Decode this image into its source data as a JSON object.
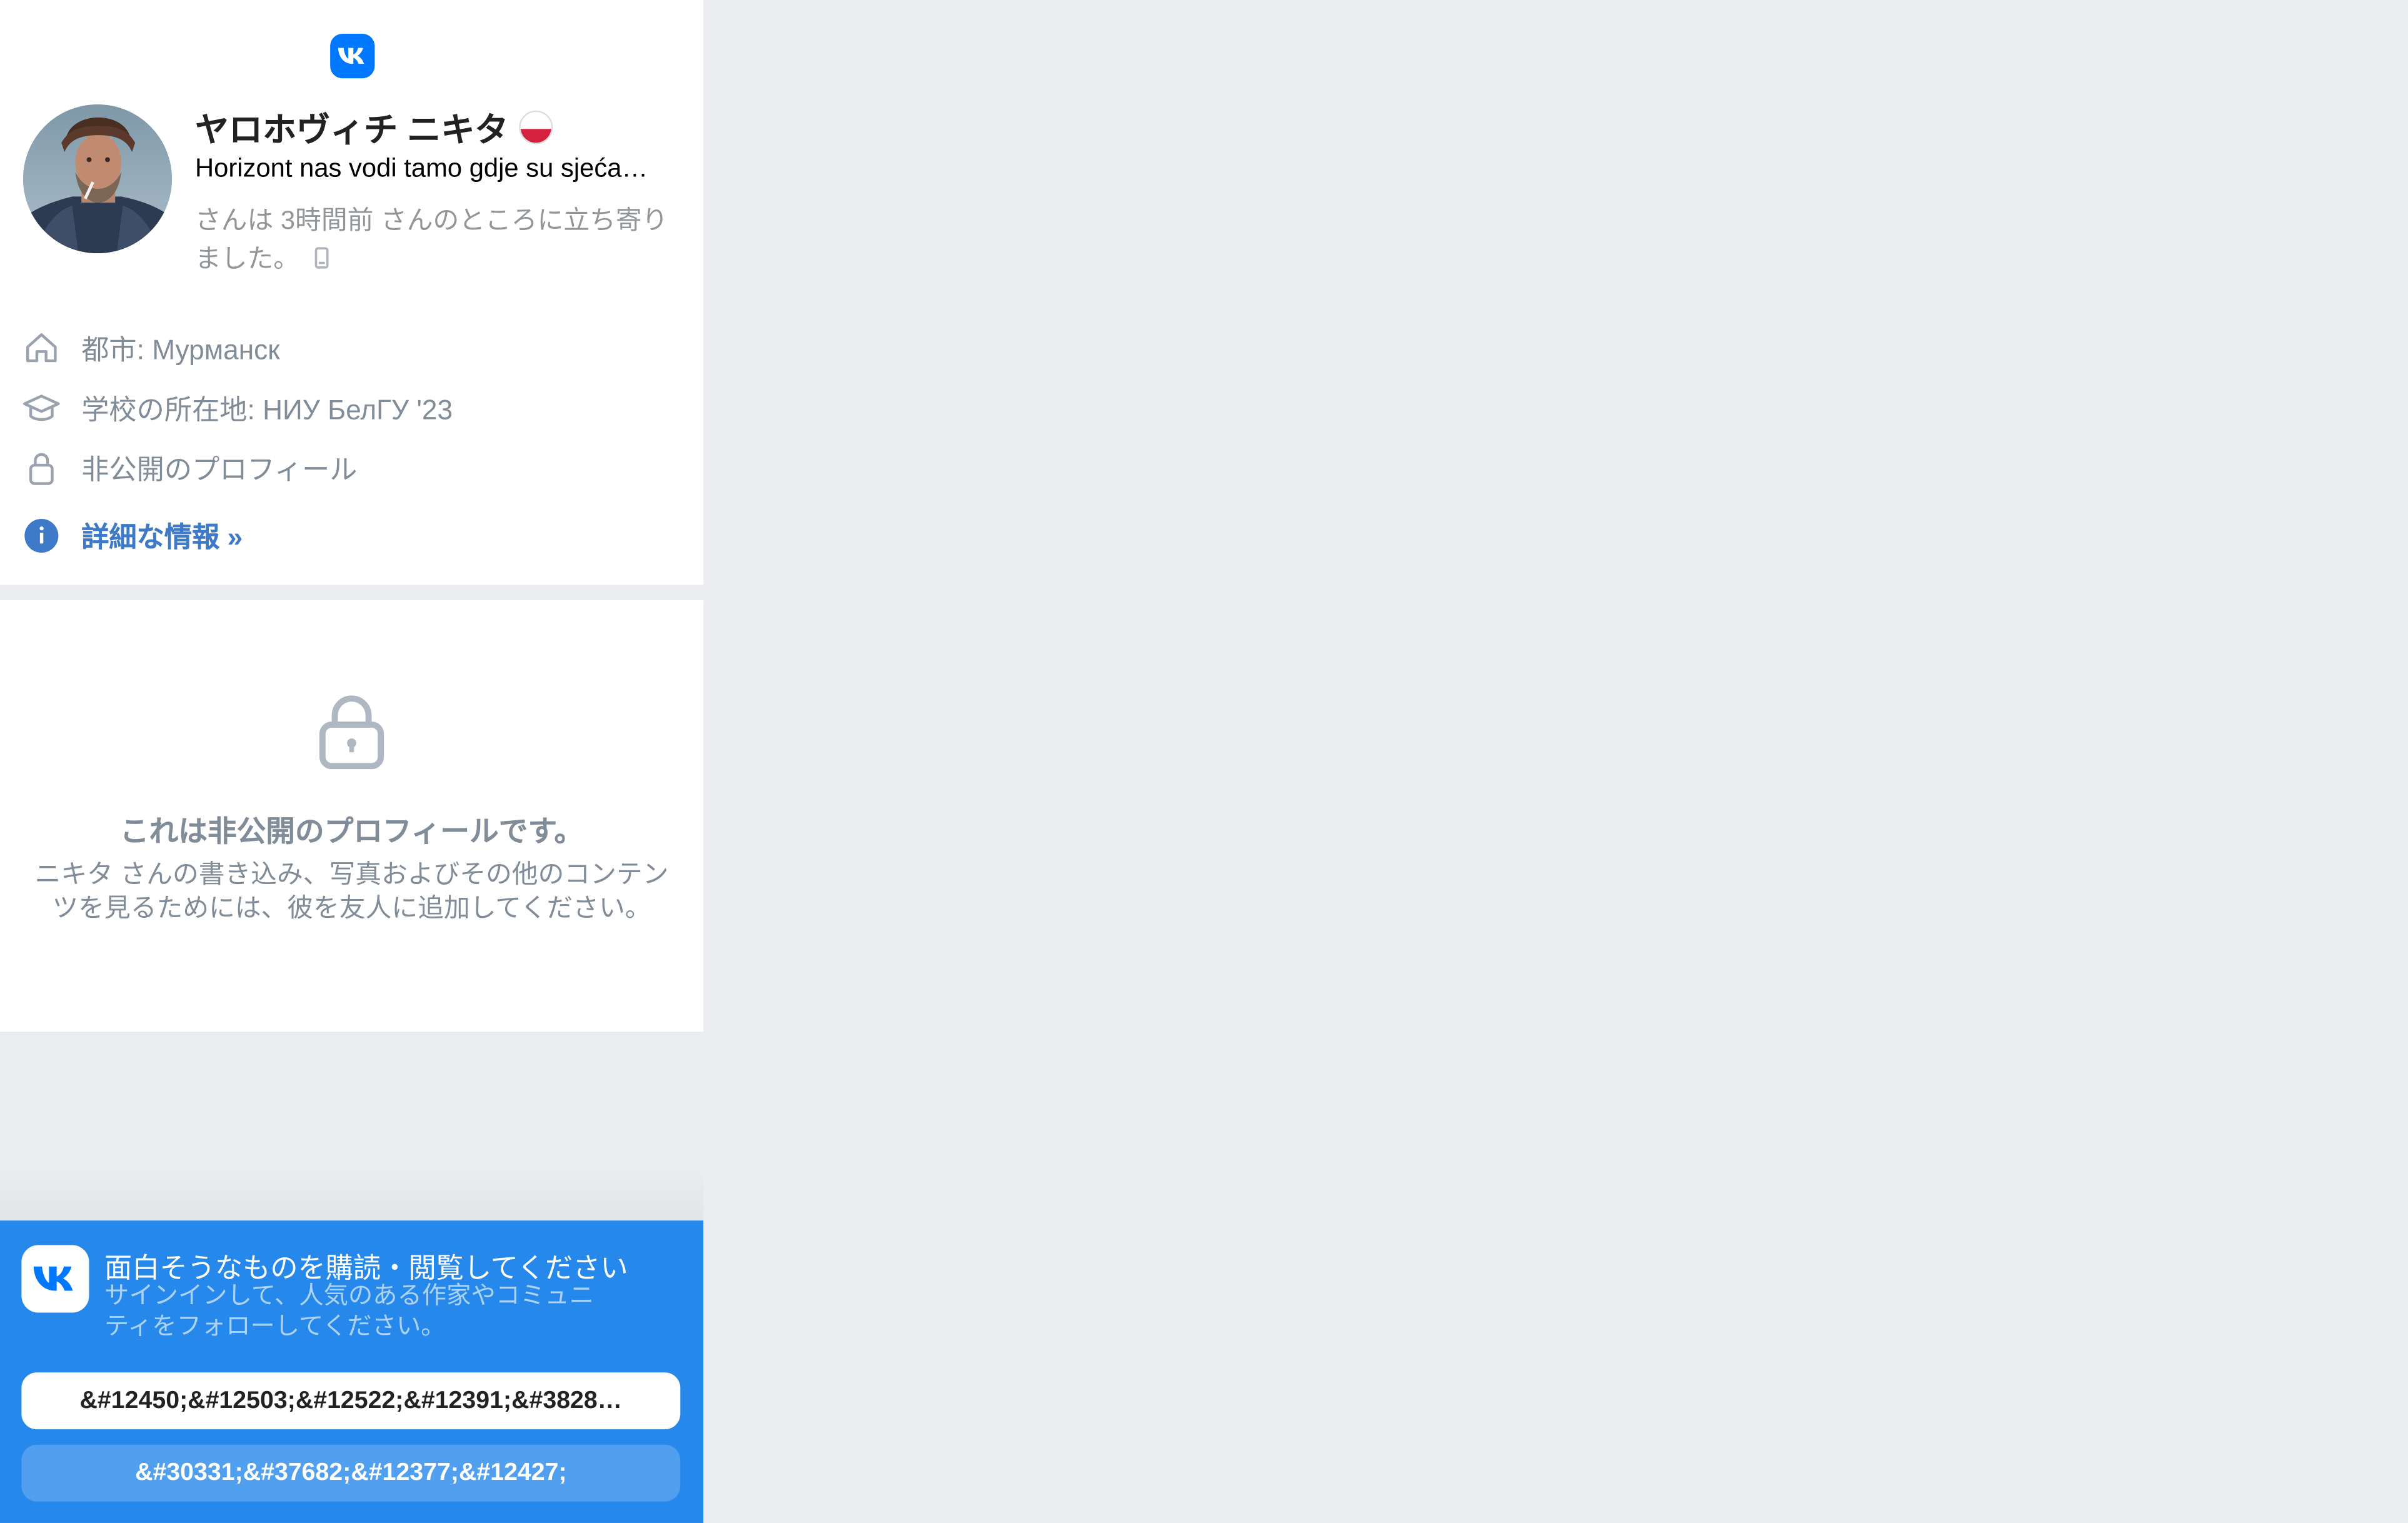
{
  "profile": {
    "name": "ヤロホヴィチ ニキタ",
    "status": "Horizont nas vodi tamo gdje su sjeća…",
    "last_seen": "さんは 3時間前 さんのところに立ち寄りました。",
    "info": {
      "city": "都市: Мурманск",
      "school": "学校の所在地: НИУ БелГУ '23",
      "privacy": "非公開のプロフィール",
      "more": "詳細な情報 »"
    }
  },
  "private_notice": {
    "title": "これは非公開のプロフィールです。",
    "text": "ニキタ さんの書き込み、写真およびその他のコンテンツを見るためには、彼を友人に追加してください。"
  },
  "banner": {
    "title": "面白そうなものを購読・閲覧してください",
    "subtitle": "サインインして、人気のある作家やコミュニティをフォローしてください。",
    "signin_button": "&#12450;&#12503;&#12522;&#12391;&#3828…",
    "register_button": "&#30331;&#37682;&#12377;&#12427;"
  },
  "colors": {
    "page_bg": "#ebedf0",
    "vk_blue": "#0077ff",
    "banner_blue": "#2688eb",
    "link_blue": "#3f7ac8",
    "muted_text": "#818c99"
  },
  "icons": [
    "vk-logo-icon",
    "poland-flag-icon",
    "mobile-phone-icon",
    "home-icon",
    "graduation-cap-icon",
    "lock-icon",
    "info-icon",
    "lock-large-icon"
  ]
}
